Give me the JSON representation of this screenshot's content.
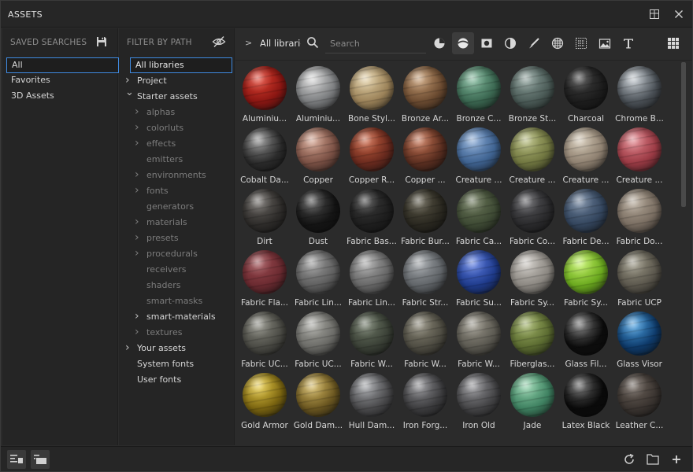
{
  "window": {
    "title": "ASSETS"
  },
  "saved_searches": {
    "header": "SAVED SEARCHES",
    "items": [
      {
        "label": "All",
        "selected": true
      },
      {
        "label": "Favorites",
        "selected": false
      },
      {
        "label": "3D Assets",
        "selected": false
      }
    ]
  },
  "filter": {
    "header": "FILTER BY PATH",
    "root": "All libraries",
    "items": [
      {
        "label": "Project",
        "arrow": ">",
        "dim": false,
        "indent": 0
      },
      {
        "label": "Starter assets",
        "arrow": "v",
        "dim": false,
        "indent": 0
      },
      {
        "label": "alphas",
        "arrow": ">",
        "dim": true,
        "indent": 1
      },
      {
        "label": "colorluts",
        "arrow": ">",
        "dim": true,
        "indent": 1
      },
      {
        "label": "effects",
        "arrow": ">",
        "dim": true,
        "indent": 1
      },
      {
        "label": "emitters",
        "arrow": "",
        "dim": true,
        "indent": 1
      },
      {
        "label": "environments",
        "arrow": ">",
        "dim": true,
        "indent": 1
      },
      {
        "label": "fonts",
        "arrow": ">",
        "dim": true,
        "indent": 1
      },
      {
        "label": "generators",
        "arrow": "",
        "dim": true,
        "indent": 1
      },
      {
        "label": "materials",
        "arrow": ">",
        "dim": true,
        "indent": 1
      },
      {
        "label": "presets",
        "arrow": ">",
        "dim": true,
        "indent": 1
      },
      {
        "label": "procedurals",
        "arrow": ">",
        "dim": true,
        "indent": 1
      },
      {
        "label": "receivers",
        "arrow": "",
        "dim": true,
        "indent": 1
      },
      {
        "label": "shaders",
        "arrow": "",
        "dim": true,
        "indent": 1
      },
      {
        "label": "smart-masks",
        "arrow": "",
        "dim": true,
        "indent": 1
      },
      {
        "label": "smart-materials",
        "arrow": ">",
        "dim": false,
        "indent": 1
      },
      {
        "label": "textures",
        "arrow": ">",
        "dim": true,
        "indent": 1
      },
      {
        "label": "Your assets",
        "arrow": ">",
        "dim": false,
        "indent": 0
      },
      {
        "label": "System fonts",
        "arrow": "",
        "dim": false,
        "indent": 0
      },
      {
        "label": "User fonts",
        "arrow": "",
        "dim": false,
        "indent": 0
      }
    ]
  },
  "toolbar": {
    "breadcrumb": "All libraries",
    "search_placeholder": "Search",
    "tools": [
      "material-filter-icon",
      "smart-material-filter-icon",
      "smart-mask-filter-icon",
      "generator-filter-icon",
      "brush-filter-icon",
      "alpha-filter-icon",
      "procedural-filter-icon",
      "environment-filter-icon",
      "font-filter-icon"
    ]
  },
  "assets": [
    {
      "label": "Aluminiu...",
      "color": "#8a1612",
      "glow": "#e04030"
    },
    {
      "label": "Aluminiu...",
      "color": "#7a7c7e",
      "glow": "#d8d8d8"
    },
    {
      "label": "Bone Styl...",
      "color": "#9a8158",
      "glow": "#e2cfa4"
    },
    {
      "label": "Bronze Ar...",
      "color": "#6a4a30",
      "glow": "#c49a70"
    },
    {
      "label": "Bronze C...",
      "color": "#3a6650",
      "glow": "#7fb89a"
    },
    {
      "label": "Bronze St...",
      "color": "#4a5a56",
      "glow": "#8a9e98"
    },
    {
      "label": "Charcoal",
      "color": "#1c1c1c",
      "glow": "#3e3e3e"
    },
    {
      "label": "Chrome B...",
      "color": "#4a5056",
      "glow": "#bfc6cc"
    },
    {
      "label": "Cobalt Da...",
      "color": "#2a2a2a",
      "glow": "#8a8a8a"
    },
    {
      "label": "Copper",
      "color": "#7a5044",
      "glow": "#d2a08c"
    },
    {
      "label": "Copper R...",
      "color": "#6a2a1e",
      "glow": "#c86040"
    },
    {
      "label": "Copper ...",
      "color": "#5a2e20",
      "glow": "#c47050"
    },
    {
      "label": "Creature ...",
      "color": "#3e6290",
      "glow": "#86a8d4"
    },
    {
      "label": "Creature ...",
      "color": "#707640",
      "glow": "#b2b878"
    },
    {
      "label": "Creature ...",
      "color": "#8e8070",
      "glow": "#d0c4b0"
    },
    {
      "label": "Creature ...",
      "color": "#9a3a44",
      "glow": "#e08088"
    },
    {
      "label": "Dirt",
      "color": "#2e2c2a",
      "glow": "#6a6662"
    },
    {
      "label": "Dust",
      "color": "#141414",
      "glow": "#4a4a4a"
    },
    {
      "label": "Fabric Bas...",
      "color": "#1e1e1e",
      "glow": "#3c3c3c"
    },
    {
      "label": "Fabric Bur...",
      "color": "#2a2820",
      "glow": "#5a5646"
    },
    {
      "label": "Fabric Ca...",
      "color": "#3e4a34",
      "glow": "#6a7658"
    },
    {
      "label": "Fabric Co...",
      "color": "#2a2a2c",
      "glow": "#5a5a5e"
    },
    {
      "label": "Fabric De...",
      "color": "#34465e",
      "glow": "#6a7e98"
    },
    {
      "label": "Fabric Do...",
      "color": "#7a6e62",
      "glow": "#b4a898"
    },
    {
      "label": "Fabric Fla...",
      "color": "#6a2a30",
      "glow": "#9c4a50"
    },
    {
      "label": "Fabric Lin...",
      "color": "#5e5e5e",
      "glow": "#9a9a9a"
    },
    {
      "label": "Fabric Lin...",
      "color": "#666666",
      "glow": "#a8a8a8"
    },
    {
      "label": "Fabric Str...",
      "color": "#606468",
      "glow": "#9ea2a6"
    },
    {
      "label": "Fabric Su...",
      "color": "#1e3a8a",
      "glow": "#5a7ae0"
    },
    {
      "label": "Fabric Sy...",
      "color": "#8a8680",
      "glow": "#cac6c0"
    },
    {
      "label": "Fabric Sy...",
      "color": "#6aa81e",
      "glow": "#c0f060"
    },
    {
      "label": "Fabric UCP",
      "color": "#5a564c",
      "glow": "#9a9684"
    },
    {
      "label": "Fabric UC...",
      "color": "#4a4a44",
      "glow": "#8a8a80"
    },
    {
      "label": "Fabric UC...",
      "color": "#6a6a66",
      "glow": "#aaaaa4"
    },
    {
      "label": "Fabric W...",
      "color": "#3a4036",
      "glow": "#6c7664"
    },
    {
      "label": "Fabric W...",
      "color": "#4e4c42",
      "glow": "#8a8676"
    },
    {
      "label": "Fabric W...",
      "color": "#5a5850",
      "glow": "#9a968a"
    },
    {
      "label": "Fiberglas...",
      "color": "#5a6a30",
      "glow": "#9eb064"
    },
    {
      "label": "Glass Fil...",
      "color": "#0c0c0c",
      "glow": "#6a6a6a"
    },
    {
      "label": "Glass Visor",
      "color": "#0e3a6a",
      "glow": "#4aa0e0"
    },
    {
      "label": "Gold Armor",
      "color": "#7a6410",
      "glow": "#e8cc48"
    },
    {
      "label": "Gold Dam...",
      "color": "#6a5620",
      "glow": "#d4b860"
    },
    {
      "label": "Hull Dam...",
      "color": "#4a4a4c",
      "glow": "#a0a2a6"
    },
    {
      "label": "Iron Forg...",
      "color": "#3c3c3e",
      "glow": "#8a8a8e"
    },
    {
      "label": "Iron Old",
      "color": "#444446",
      "glow": "#929296"
    },
    {
      "label": "Jade",
      "color": "#3e8060",
      "glow": "#8ed0a8"
    },
    {
      "label": "Latex Black",
      "color": "#0a0a0a",
      "glow": "#5a5a5a"
    },
    {
      "label": "Leather C...",
      "color": "#3a3430",
      "glow": "#6c625a"
    }
  ],
  "footer": {
    "left_buttons": [
      "list-view-icon",
      "grid-view-icon"
    ],
    "right_buttons": [
      "refresh-icon",
      "new-folder-icon",
      "add-icon"
    ]
  }
}
